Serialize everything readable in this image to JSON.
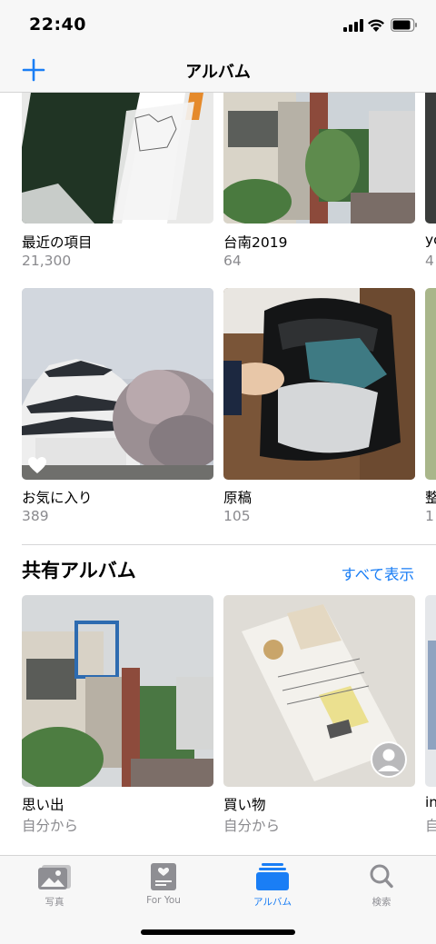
{
  "status": {
    "time": "22:40"
  },
  "nav": {
    "title": "アルバム"
  },
  "albums": [
    {
      "label": "最近の項目",
      "count": "21,300"
    },
    {
      "label": "台南2019",
      "count": "64"
    },
    {
      "label": "yo",
      "count": "4"
    },
    {
      "label": "お気に入り",
      "count": "389"
    },
    {
      "label": "原稿",
      "count": "105"
    },
    {
      "label": "整",
      "count": "1"
    }
  ],
  "shared": {
    "title": "共有アルバム",
    "see_all": "すべて表示",
    "albums": [
      {
        "label": "思い出",
        "owner": "自分から"
      },
      {
        "label": "買い物",
        "owner": "自分から"
      },
      {
        "label": "in",
        "owner": "自"
      }
    ]
  },
  "tabs": [
    {
      "label": "写真",
      "icon": "photos-icon",
      "active": false
    },
    {
      "label": "For You",
      "icon": "for-you-icon",
      "active": false
    },
    {
      "label": "アルバム",
      "icon": "albums-icon",
      "active": true
    },
    {
      "label": "検索",
      "icon": "search-icon",
      "active": false
    }
  ],
  "colors": {
    "accent": "#1a7ef5",
    "secondary_text": "#8a8a8e",
    "bar_bg": "#f7f7f7"
  }
}
